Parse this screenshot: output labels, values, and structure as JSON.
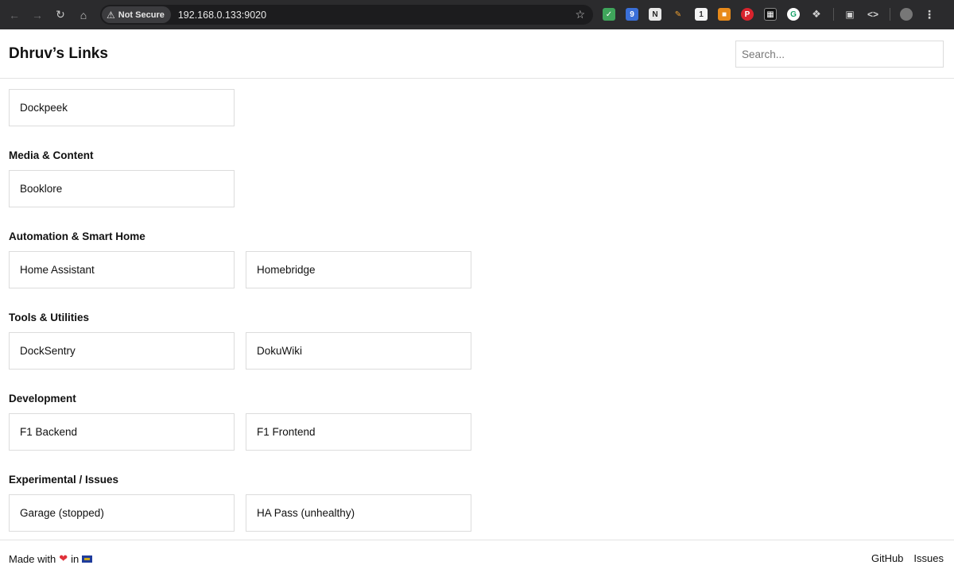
{
  "browser": {
    "security_label": "Not Secure",
    "url": "192.168.0.133:9020",
    "icons": [
      "back-icon",
      "forward-icon",
      "reload-icon",
      "home-icon",
      "bookmark-star-icon",
      "extensions-icon",
      "menu-icon"
    ]
  },
  "header": {
    "title": "Dhruv’s Links",
    "search_placeholder": "Search..."
  },
  "groups": [
    {
      "title": "",
      "links": [
        "Dockpeek"
      ]
    },
    {
      "title": "Media & Content",
      "links": [
        "Booklore"
      ]
    },
    {
      "title": "Automation & Smart Home",
      "links": [
        "Home Assistant",
        "Homebridge"
      ]
    },
    {
      "title": "Tools & Utilities",
      "links": [
        "DockSentry",
        "DokuWiki"
      ]
    },
    {
      "title": "Development",
      "links": [
        "F1 Backend",
        "F1 Frontend"
      ]
    },
    {
      "title": "Experimental / Issues",
      "links": [
        "Garage (stopped)",
        "HA Pass (unhealthy)"
      ]
    }
  ],
  "footer": {
    "made_with": "Made with",
    "in_text": "in",
    "links": [
      "GitHub",
      "Issues"
    ]
  },
  "colors": {
    "accent_heart": "#e0303a",
    "border": "#dcdcdc",
    "chrome_bg": "#2b2b2d"
  }
}
